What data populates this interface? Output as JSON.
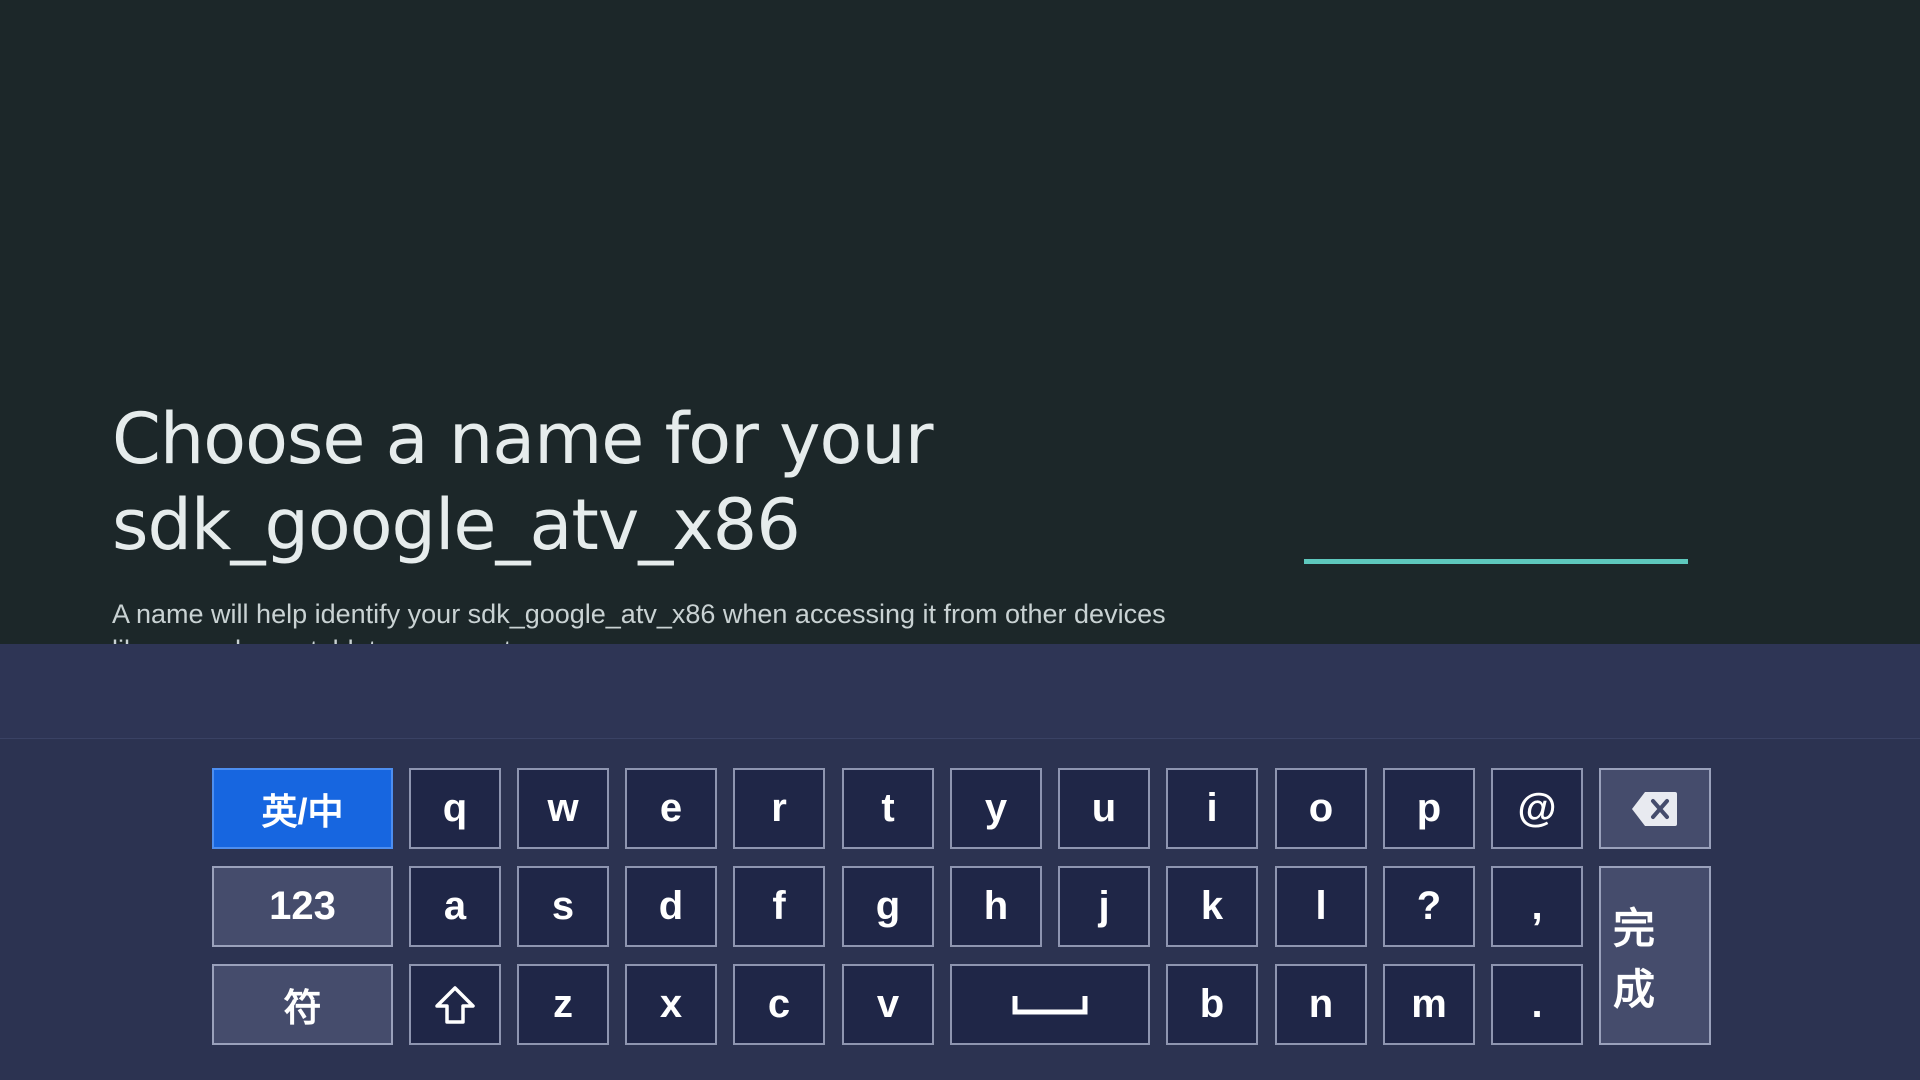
{
  "page": {
    "title_line1": "Choose a name for your",
    "title_line2": "sdk_google_atv_x86",
    "description": "A name will help identify your sdk_google_atv_x86 when accessing it from other devices like your phone, tablet, or computer.",
    "name_input_value": ""
  },
  "keyboard": {
    "lang_toggle": "英/中",
    "numbers_key": "123",
    "symbols_key": "符",
    "done_key": "完成",
    "row1": [
      "q",
      "w",
      "e",
      "r",
      "t",
      "y",
      "u",
      "i",
      "o",
      "p",
      "@"
    ],
    "row2": [
      "a",
      "s",
      "d",
      "f",
      "g",
      "h",
      "j",
      "k",
      "l",
      "?",
      ","
    ],
    "row3a": [
      "z",
      "x",
      "c",
      "v"
    ],
    "row3b": [
      "b",
      "n",
      "m",
      "."
    ],
    "icons": {
      "backspace": "backspace-icon",
      "shift": "shift-icon",
      "space": "space-icon"
    }
  },
  "colors": {
    "accent_underline": "#5ec8bd",
    "keyboard_bg": "#2c3351",
    "active_key": "#1766e0"
  }
}
